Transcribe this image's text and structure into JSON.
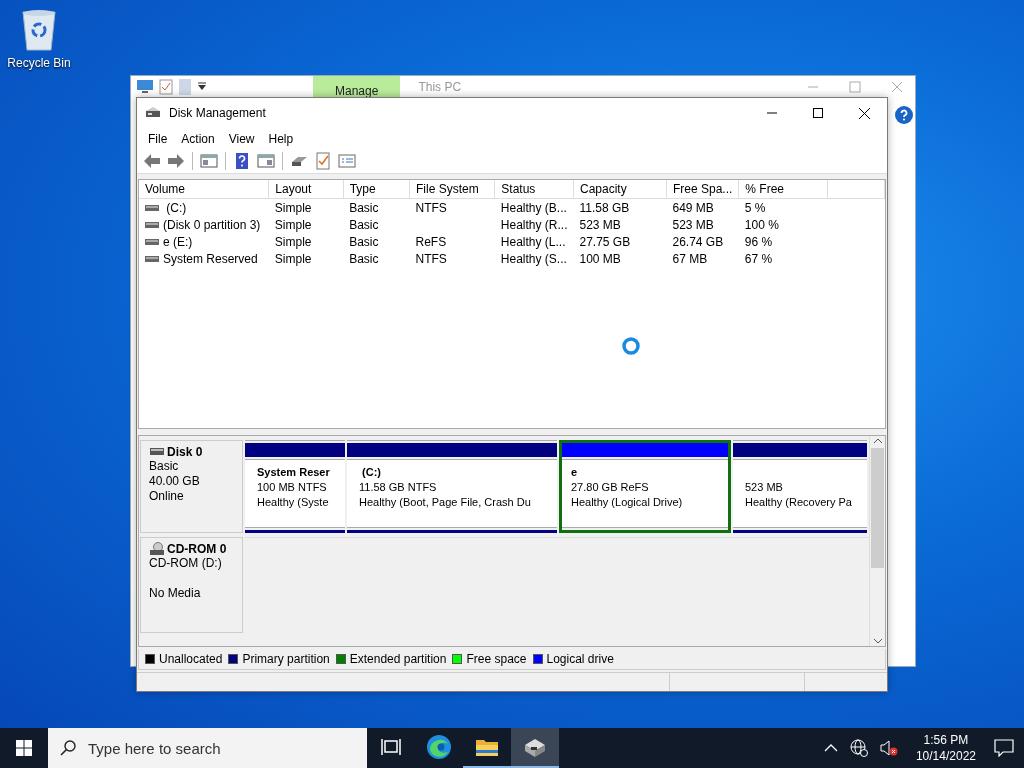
{
  "desktop_icons": [
    {
      "label": "Recycle Bin"
    }
  ],
  "background_window": {
    "ribbon_tab": {
      "label": "Manage",
      "selected": true
    },
    "title": "This PC"
  },
  "window": {
    "title": "Disk Management",
    "menu": [
      "File",
      "Action",
      "View",
      "Help"
    ],
    "volume_table": {
      "columns": [
        "Volume",
        "Layout",
        "Type",
        "File System",
        "Status",
        "Capacity",
        "Free Spa...",
        "% Free"
      ],
      "rows": [
        {
          "cells": [
            " (C:)",
            "Simple",
            "Basic",
            "NTFS",
            "Healthy (B...",
            "11.58 GB",
            "649 MB",
            "5 %"
          ]
        },
        {
          "cells": [
            "(Disk 0 partition 3)",
            "Simple",
            "Basic",
            "",
            "Healthy (R...",
            "523 MB",
            "523 MB",
            "100 %"
          ]
        },
        {
          "cells": [
            "e (E:)",
            "Simple",
            "Basic",
            "ReFS",
            "Healthy (L...",
            "27.75 GB",
            "26.74 GB",
            "96 %"
          ]
        },
        {
          "cells": [
            "System Reserved",
            "Simple",
            "Basic",
            "NTFS",
            "Healthy (S...",
            "100 MB",
            "67 MB",
            "67 %"
          ]
        }
      ]
    },
    "disks": [
      {
        "kind": "disk",
        "name": "Disk 0",
        "info": [
          "Basic",
          "40.00 GB",
          "Online"
        ],
        "partitions": [
          {
            "kind": "primary",
            "name": "System Reser",
            "size": "100 MB NTFS",
            "status": "Healthy (Syste",
            "selected": false
          },
          {
            "kind": "primary",
            "name": " (C:)",
            "size": "11.58 GB NTFS",
            "status": "Healthy (Boot, Page File, Crash Du",
            "selected": false
          },
          {
            "kind": "logical",
            "name": "e",
            "size": "27.80 GB ReFS",
            "status": "Healthy (Logical Drive)",
            "selected": true
          },
          {
            "kind": "primary",
            "size": "523 MB",
            "status": "Healthy (Recovery Pa",
            "selected": false
          }
        ]
      },
      {
        "kind": "cdrom",
        "name": "CD-ROM 0",
        "info": [
          "CD-ROM (D:)",
          "No Media"
        ]
      }
    ],
    "legend": [
      {
        "label": "Unallocated",
        "color": "#000000"
      },
      {
        "label": "Primary partition",
        "color": "#000080"
      },
      {
        "label": "Extended partition",
        "color": "#008000"
      },
      {
        "label": "Free space",
        "color": "#00ff00"
      },
      {
        "label": "Logical drive",
        "color": "#0000ff"
      }
    ]
  },
  "taskbar": {
    "search": {
      "placeholder": "Type here to search"
    },
    "apps": [
      {
        "kind": "task-view",
        "selected": false,
        "running": false
      },
      {
        "kind": "edge",
        "selected": false,
        "running": false
      },
      {
        "kind": "explorer",
        "selected": false,
        "running": true
      },
      {
        "kind": "disk-management",
        "selected": true,
        "running": true
      }
    ],
    "time": "1:56 PM",
    "date": "10/14/2022"
  }
}
